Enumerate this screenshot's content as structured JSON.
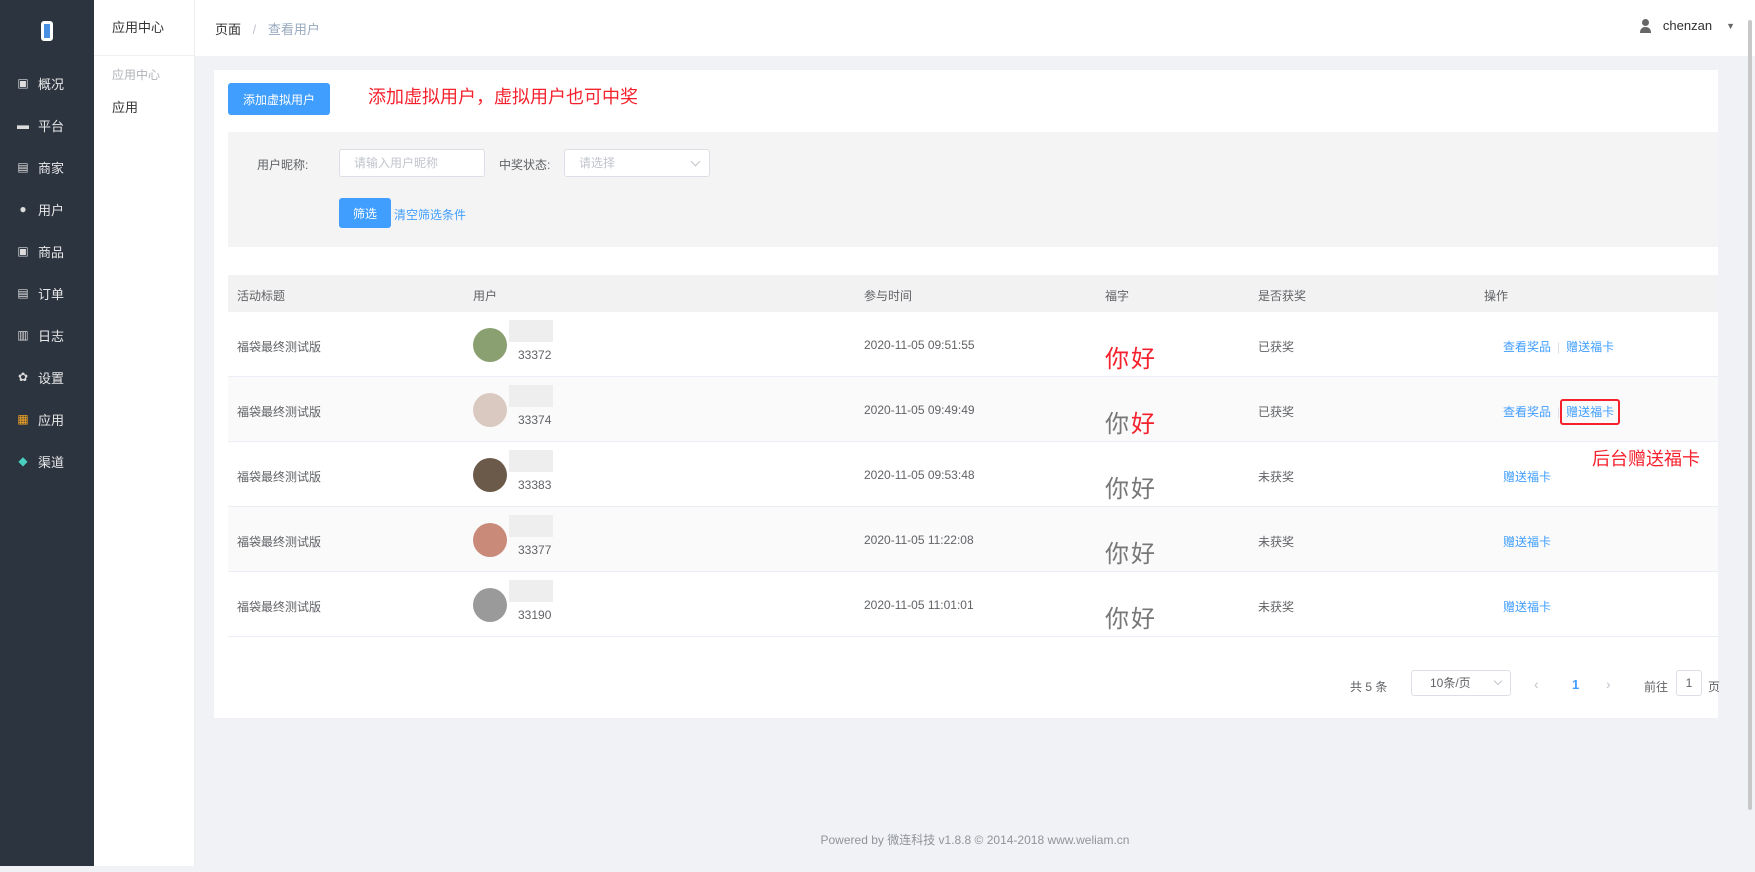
{
  "sidebar": {
    "items": [
      {
        "label": "概况",
        "icon": "dashboard-icon"
      },
      {
        "label": "平台",
        "icon": "monitor-icon"
      },
      {
        "label": "商家",
        "icon": "store-icon"
      },
      {
        "label": "用户",
        "icon": "user-icon"
      },
      {
        "label": "商品",
        "icon": "goods-icon"
      },
      {
        "label": "订单",
        "icon": "order-icon"
      },
      {
        "label": "日志",
        "icon": "log-icon"
      },
      {
        "label": "设置",
        "icon": "gear-icon"
      },
      {
        "label": "应用",
        "icon": "apps-icon"
      },
      {
        "label": "渠道",
        "icon": "channel-icon"
      }
    ]
  },
  "subsidebar": {
    "title": "应用中心",
    "group": "应用中心",
    "item": "应用"
  },
  "header": {
    "breadcrumb_root": "页面",
    "breadcrumb_sep": "/",
    "breadcrumb_current": "查看用户",
    "username": "chenzan"
  },
  "toolbar": {
    "add_button": "添加虚拟用户",
    "note_add": "添加虚拟用户，虚拟用户也可中奖",
    "note_send": "后台赠送福卡"
  },
  "filter": {
    "nickname_label": "用户昵称:",
    "nickname_placeholder": "请输入用户昵称",
    "status_label": "中奖状态:",
    "status_placeholder": "请选择",
    "filter_button": "筛选",
    "clear_link": "清空筛选条件"
  },
  "table": {
    "headers": [
      "活动标题",
      "用户",
      "参与时间",
      "福字",
      "是否获奖",
      "操作"
    ],
    "rows": [
      {
        "title": "福袋最终测试版",
        "uid": "33372",
        "time": "2020-11-05 09:51:55",
        "fu1": "你",
        "fu2": "好",
        "fu1_red": true,
        "fu2_red": true,
        "won": "已获奖",
        "actions": [
          "查看奖品",
          "赠送福卡"
        ],
        "avatar_color": "#8aa070"
      },
      {
        "title": "福袋最终测试版",
        "uid": "33374",
        "time": "2020-11-05 09:49:49",
        "fu1": "你",
        "fu2": "好",
        "fu1_red": false,
        "fu2_red": true,
        "won": "已获奖",
        "actions": [
          "查看奖品",
          "赠送福卡"
        ],
        "avatar_color": "#d9c9c0"
      },
      {
        "title": "福袋最终测试版",
        "uid": "33383",
        "time": "2020-11-05 09:53:48",
        "fu1": "你",
        "fu2": "好",
        "fu1_red": false,
        "fu2_red": false,
        "won": "未获奖",
        "actions": [
          "赠送福卡"
        ],
        "avatar_color": "#6b5a4a"
      },
      {
        "title": "福袋最终测试版",
        "uid": "33377",
        "time": "2020-11-05 11:22:08",
        "fu1": "你",
        "fu2": "好",
        "fu1_red": false,
        "fu2_red": false,
        "won": "未获奖",
        "actions": [
          "赠送福卡"
        ],
        "avatar_color": "#c98a7a"
      },
      {
        "title": "福袋最终测试版",
        "uid": "33190",
        "time": "2020-11-05 11:01:01",
        "fu1": "你",
        "fu2": "好",
        "fu1_red": false,
        "fu2_red": false,
        "won": "未获奖",
        "actions": [
          "赠送福卡"
        ],
        "avatar_color": "#9a9a9a"
      }
    ]
  },
  "pagination": {
    "total": "共 5 条",
    "page_size": "10条/页",
    "current_page": "1",
    "goto_prefix": "前往",
    "goto_value": "1",
    "goto_suffix": "页"
  },
  "footer": "Powered by 微连科技 v1.8.8 © 2014-2018 www.weliam.cn",
  "colors": {
    "primary": "#409eff",
    "sidebar_bg": "#2c3440",
    "alert_red": "#f5222d"
  }
}
